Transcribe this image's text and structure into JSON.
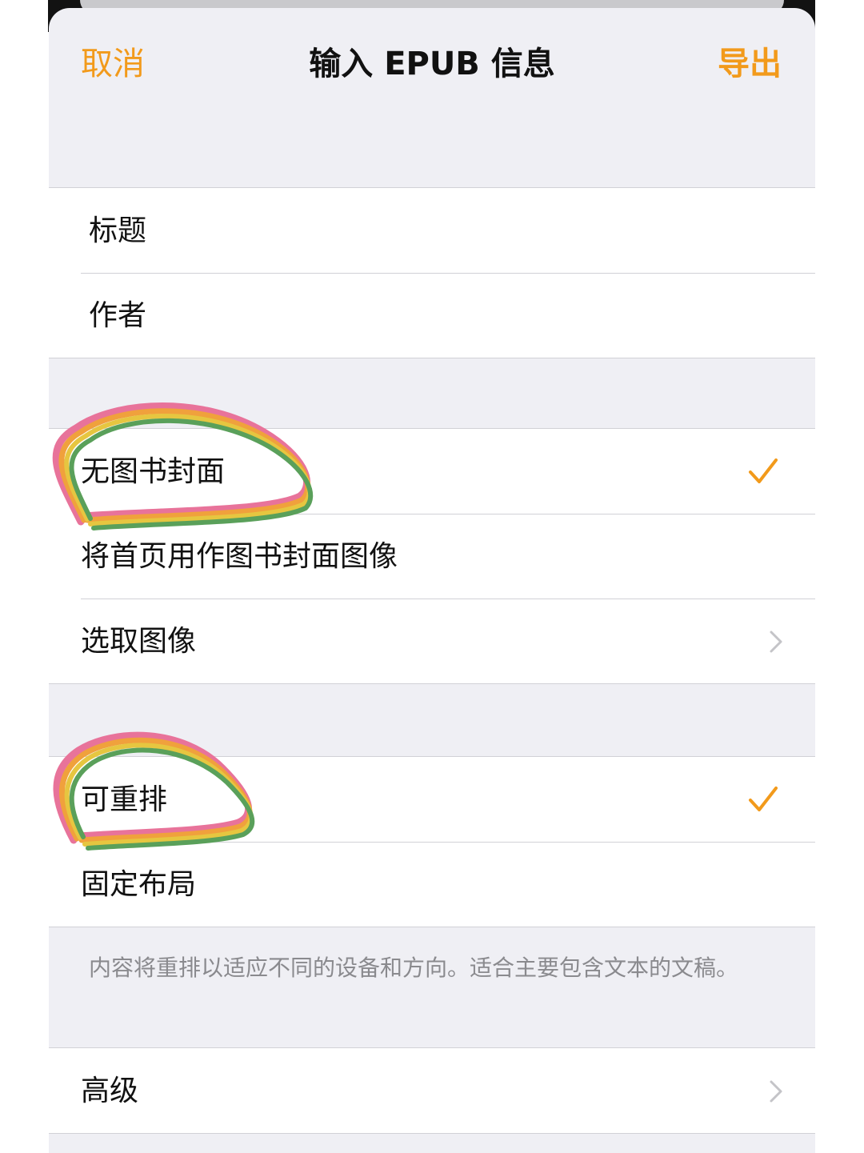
{
  "nav": {
    "cancel_label": "取消",
    "title": "输入 EPUB 信息",
    "export_label": "导出"
  },
  "metadata_fields": [
    {
      "label": "标题"
    },
    {
      "label": "作者"
    }
  ],
  "cover_options": [
    {
      "label": "无图书封面",
      "selected": true
    },
    {
      "label": "将首页用作图书封面图像",
      "selected": false
    },
    {
      "label": "选取图像",
      "disclosure": true
    }
  ],
  "layout_options": [
    {
      "label": "可重排",
      "selected": true
    },
    {
      "label": "固定布局",
      "selected": false
    }
  ],
  "layout_footnote": "内容将重排以适应不同的设备和方向。适合主要包含文本的文稿。",
  "advanced": {
    "label": "高级"
  },
  "colors": {
    "accent": "#f29a1b",
    "group_background": "#efeff4",
    "separator": "#d1d1d6",
    "footnote_text": "#8a8a8e",
    "marker_pink": "#e8739a",
    "marker_orange": "#f0a13c",
    "marker_yellow": "#e6c640",
    "marker_green": "#5aa05a"
  }
}
